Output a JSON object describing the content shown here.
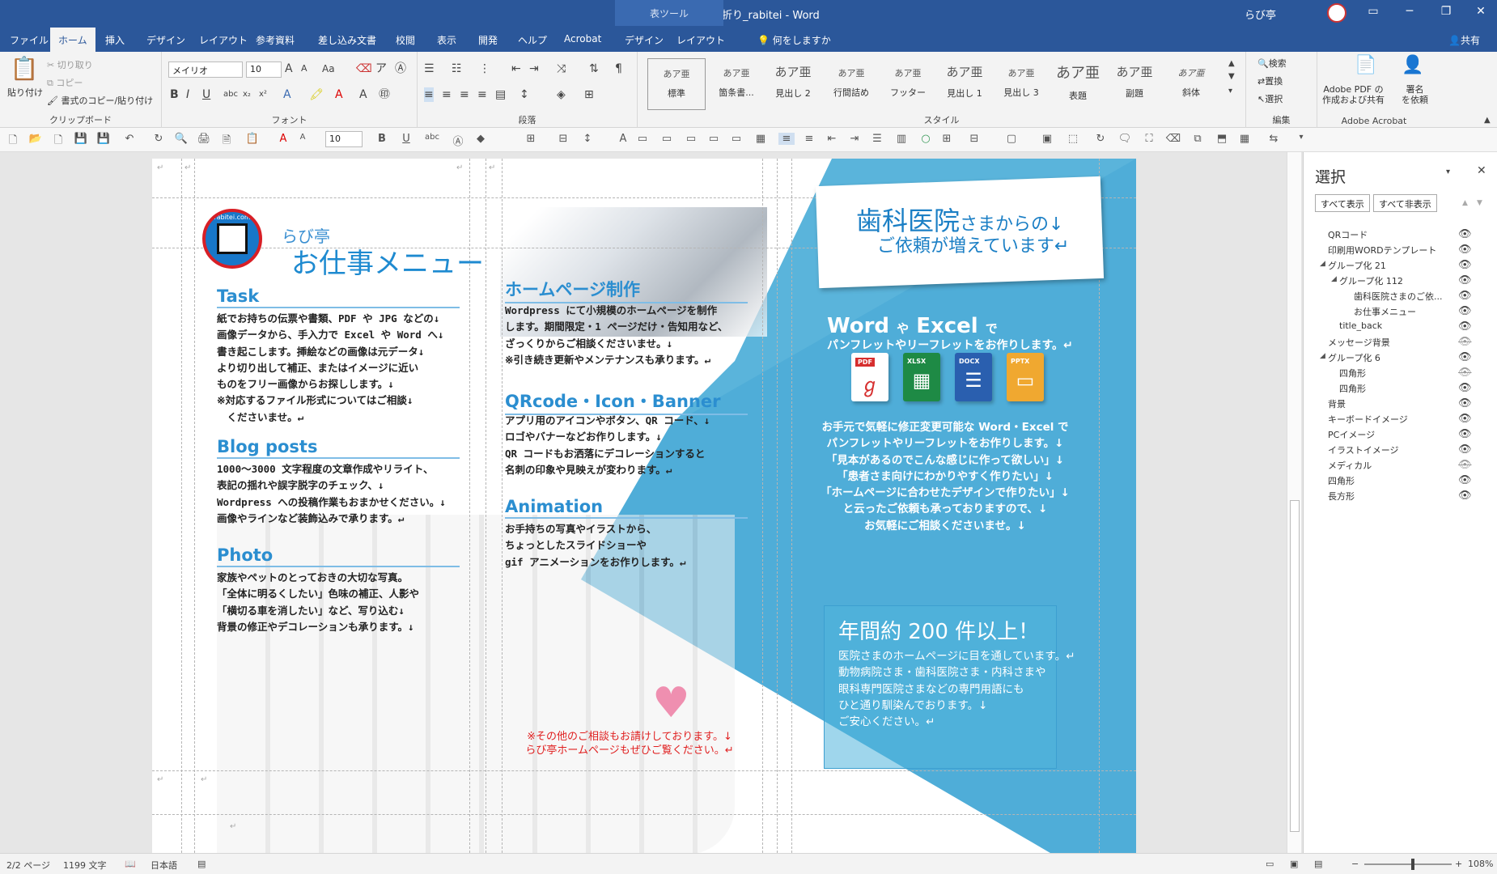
{
  "window": {
    "title": "★A4三つ折り_rabitei - Word",
    "context_tab_group": "表ツール",
    "user": "らび亭"
  },
  "tabs": [
    {
      "label": "ファイル"
    },
    {
      "label": "ホーム"
    },
    {
      "label": "挿入"
    },
    {
      "label": "デザイン"
    },
    {
      "label": "レイアウト"
    },
    {
      "label": "参考資料"
    },
    {
      "label": "差し込み文書"
    },
    {
      "label": "校閲"
    },
    {
      "label": "表示"
    },
    {
      "label": "開発"
    },
    {
      "label": "ヘルプ"
    },
    {
      "label": "Acrobat"
    },
    {
      "label": "デザイン"
    },
    {
      "label": "レイアウト"
    }
  ],
  "active_tab": "ホーム",
  "tell_me": "何をしますか",
  "share": "共有",
  "ribbon": {
    "clipboard": {
      "paste": "貼り付け",
      "cut": "切り取り",
      "copy": "コピー",
      "format_painter": "書式のコピー/貼り付け",
      "label": "クリップボード"
    },
    "font": {
      "name": "メイリオ",
      "size": "10",
      "label": "フォント"
    },
    "paragraph": {
      "label": "段落"
    },
    "styles": {
      "label": "スタイル",
      "items": [
        {
          "sample": "あア亜",
          "name": "標準"
        },
        {
          "sample": "あア亜",
          "name": "箇条書..."
        },
        {
          "sample": "あア亜",
          "name": "見出し 2"
        },
        {
          "sample": "あア亜",
          "name": "行間詰め"
        },
        {
          "sample": "あア亜",
          "name": "フッター"
        },
        {
          "sample": "あア亜",
          "name": "見出し 1"
        },
        {
          "sample": "あア亜",
          "name": "見出し 3"
        },
        {
          "sample": "あア亜",
          "name": "表題"
        },
        {
          "sample": "あア亜",
          "name": "副題"
        },
        {
          "sample": "あア亜",
          "name": "斜体"
        }
      ]
    },
    "editing": {
      "find": "検索",
      "replace": "置換",
      "select": "選択",
      "label": "編集"
    },
    "acrobat": {
      "create_pdf": "Adobe PDF の\n作成および共有",
      "sign": "署名\nを依頼",
      "label": "Adobe Acrobat"
    }
  },
  "qat": {
    "font_size": "10"
  },
  "document": {
    "logo_text": "rabitei.com",
    "brand": "らび亭",
    "menu_title": "お仕事メニュー",
    "sections": [
      {
        "heading": "Task",
        "body": "紙でお持ちの伝票や書類、PDF や JPG などの↓\n画像データから、手入力で Excel や Word へ↓\n書き起こします。挿絵などの画像は元データ↓\nより切り出して補正、またはイメージに近い\nものをフリー画像からお探しします。↓\n※対応するファイル形式についてはご相談↓\n　くださいませ。↵"
      },
      {
        "heading": "Blog posts",
        "body": "1000～3000 文字程度の文章作成やリライト、\n表記の揺れや誤字脱字のチェック、↓\nWordpress への投稿作業もおまかせください。↓\n画像やラインなど装飾込みで承ります。↵"
      },
      {
        "heading": "Photo",
        "body": "家族やペットのとっておきの大切な写真。\n「全体に明るくしたい」色味の補正、人影や\n「横切る車を消したい」など、写り込む↓\n背景の修正やデコレーションも承ります。↓"
      },
      {
        "heading": "ホームページ制作",
        "body": "Wordpress にて小規模のホームページを制作\nします。期間限定・1 ページだけ・告知用など、\nざっくりからご相談くださいませ。↓\n※引き続き更新やメンテナンスも承ります。↵"
      },
      {
        "heading": "QRcode・Icon・Banner",
        "body": "アプリ用のアイコンやボタン、QR コード、↓\nロゴやバナーなどお作りします。↓\nQR コードもお洒落にデコレーションすると\n名刺の印象や見映えが変わります。↵"
      },
      {
        "heading": "Animation",
        "body": "お手持ちの写真やイラストから、\nちょっとしたスライドショーや\ngif アニメーションをお作りします。↵"
      }
    ],
    "other_note": "※その他のご相談もお請けしております。↓\nらび亭ホームページもぜひご覧ください。↵",
    "dental_note_1": "歯科医院",
    "dental_note_1b": "さまからの↓",
    "dental_note_2": "ご依頼が増えています↵",
    "word_excel_1": "Word",
    "word_excel_ya": "や",
    "word_excel_2": "Excel",
    "word_excel_de": "で",
    "word_excel_sub": "パンフレットやリーフレットをお作りします。↵",
    "file_icons": [
      {
        "label": "PDF",
        "color": "#ffffff"
      },
      {
        "label": "XLSX",
        "color": "#1e8a45"
      },
      {
        "label": "DOCX",
        "color": "#2a5faf"
      },
      {
        "label": "PPTX",
        "color": "#f0a830"
      }
    ],
    "word_body": "お手元で気軽に修正変更可能な Word・Excel で\nパンフレットやリーフレットをお作りします。↓\n「見本があるのでこんな感じに作って欲しい」↓\n「患者さま向けにわかりやすく作りたい」↓\n「ホームページに合わせたデザインで作りたい」↓\nと云ったご依頼も承っておりますので、↓\nお気軽にご相談くださいませ。↓",
    "count_title": "年間約 200 件以上！",
    "count_body": "医院さまのホームページに目を通しています。↵\n動物病院さま・歯科医院さま・内科さまや\n眼科専門医院さまなどの専門用語にも\nひと通り馴染んでおります。↓\nご安心ください。↵"
  },
  "selection_pane": {
    "title": "選択",
    "show_all": "すべて表示",
    "hide_all": "すべて非表示",
    "items": [
      {
        "label": "QRコード",
        "hidden": false
      },
      {
        "label": "印刷用WORDテンプレート",
        "hidden": false
      },
      {
        "label": "グループ化 21",
        "hidden": false
      },
      {
        "label": "グループ化 112",
        "hidden": false
      },
      {
        "label": "歯科医院さまのご依...",
        "hidden": false
      },
      {
        "label": "お仕事メニュー",
        "hidden": false
      },
      {
        "label": "title_back",
        "hidden": false
      },
      {
        "label": "メッセージ背景",
        "hidden": true
      },
      {
        "label": "グループ化 6",
        "hidden": false
      },
      {
        "label": "四角形",
        "hidden": true
      },
      {
        "label": "四角形",
        "hidden": false
      },
      {
        "label": "背景",
        "hidden": false
      },
      {
        "label": "キーボードイメージ",
        "hidden": false
      },
      {
        "label": "PCイメージ",
        "hidden": false
      },
      {
        "label": "イラストイメージ",
        "hidden": false
      },
      {
        "label": "メディカル",
        "hidden": true
      },
      {
        "label": "四角形",
        "hidden": false
      },
      {
        "label": "長方形",
        "hidden": false
      }
    ]
  },
  "status": {
    "page": "2/2 ページ",
    "words": "1199 文字",
    "language": "日本語",
    "zoom": "108%"
  },
  "colors": {
    "title_bar": "#2b579a",
    "accent_blue": "#3aaed8",
    "heading_blue": "#2b8ed0"
  }
}
